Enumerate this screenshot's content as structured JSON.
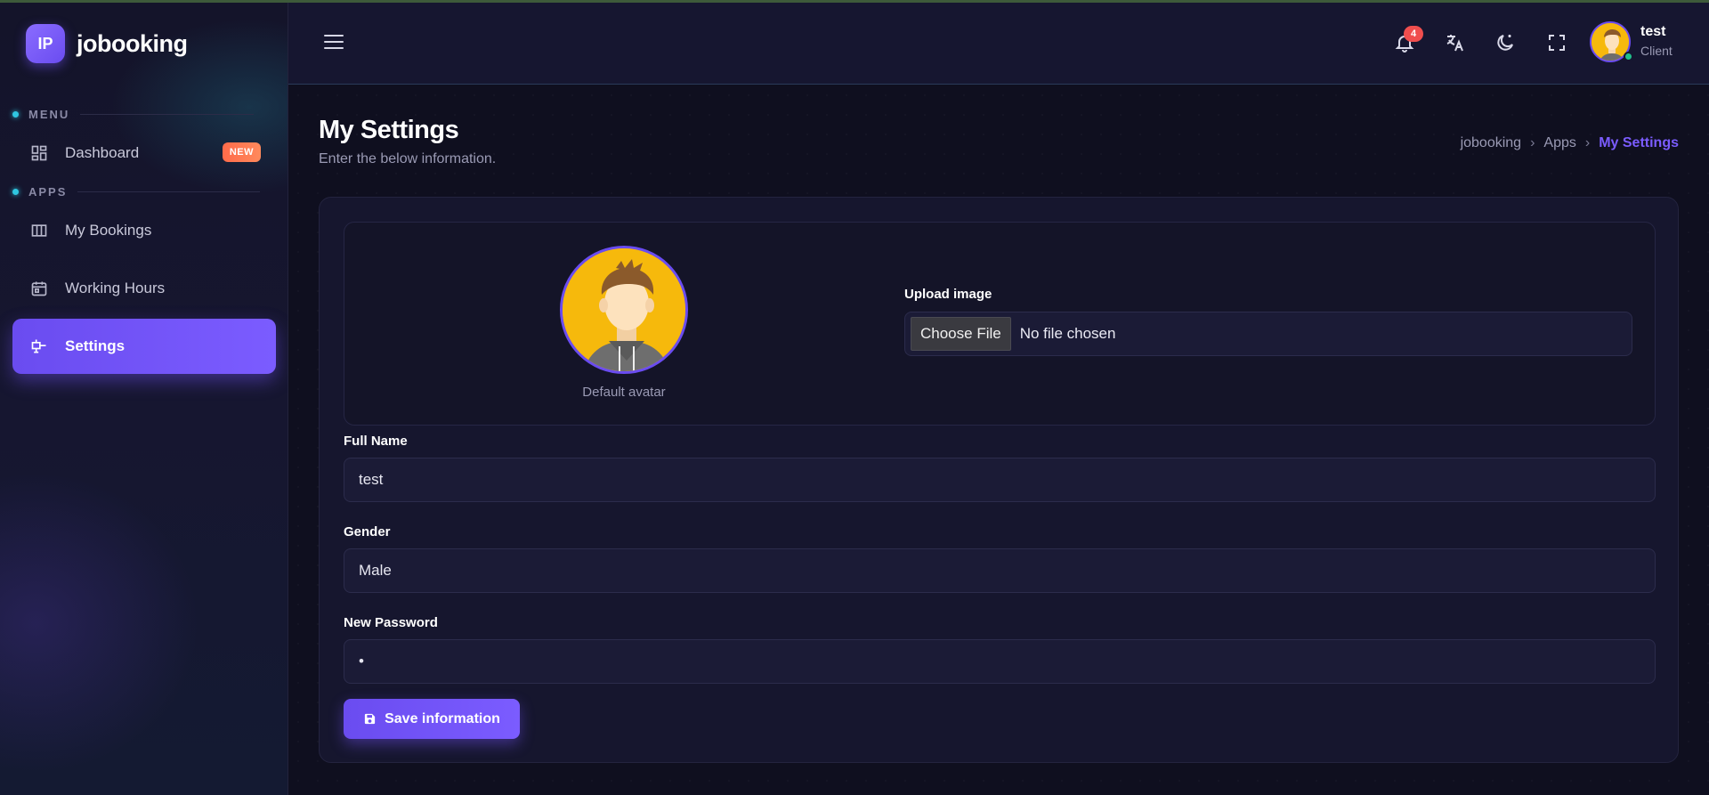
{
  "brand": {
    "logo_text": "IP",
    "name": "jobooking"
  },
  "sidebar": {
    "sections": [
      {
        "label": "MENU"
      },
      {
        "label": "APPS"
      }
    ],
    "items": [
      {
        "label": "Dashboard",
        "icon": "dashboard-icon",
        "badge": "NEW"
      },
      {
        "label": "My Bookings",
        "icon": "columns-icon"
      },
      {
        "label": "Working Hours",
        "icon": "calendar-icon"
      },
      {
        "label": "Settings",
        "icon": "settings-icon",
        "active": true
      }
    ]
  },
  "header": {
    "notifications_count": "4",
    "icons": [
      "menu-icon",
      "bell-icon",
      "translate-icon",
      "moon-icon",
      "fullscreen-icon"
    ],
    "user": {
      "name": "test",
      "role": "Client",
      "status_color": "#21c08b"
    }
  },
  "page": {
    "title": "My Settings",
    "subtitle": "Enter the below information.",
    "breadcrumb": [
      "jobooking",
      "Apps",
      "My Settings"
    ]
  },
  "form": {
    "avatar_caption": "Default avatar",
    "upload_label": "Upload image",
    "choose_file_label": "Choose File",
    "no_file_text": "No file chosen",
    "full_name_label": "Full Name",
    "full_name_value": "test",
    "gender_label": "Gender",
    "gender_value": "Male",
    "password_label": "New Password",
    "password_value": "•",
    "save_label": "Save information"
  },
  "colors": {
    "accent": "#6a4cf0",
    "badge": "#ff6b4a",
    "notification": "#f04e4e",
    "background": "#0f0f1f"
  }
}
